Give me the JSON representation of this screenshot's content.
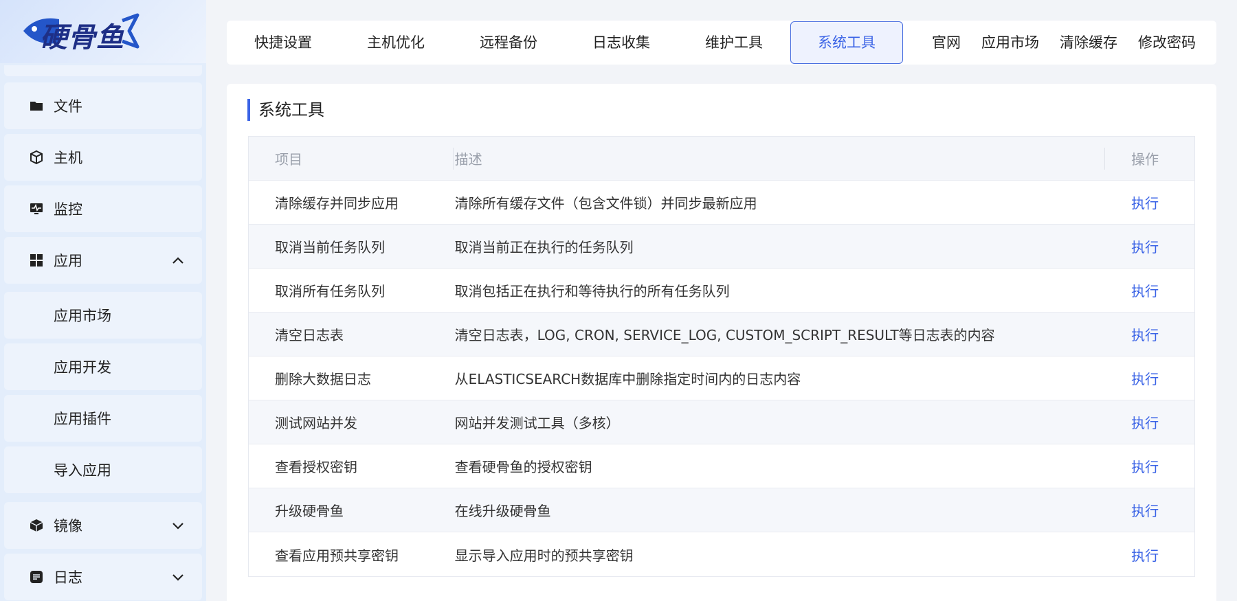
{
  "sidebar": {
    "logo_text": "硬骨鱼",
    "items": [
      {
        "label": "文件",
        "icon": "folder-icon"
      },
      {
        "label": "主机",
        "icon": "cube-icon"
      },
      {
        "label": "监控",
        "icon": "monitor-icon"
      },
      {
        "label": "应用",
        "icon": "grid-icon",
        "expanded": true
      },
      {
        "label": "应用市场",
        "sub": true
      },
      {
        "label": "应用开发",
        "sub": true
      },
      {
        "label": "应用插件",
        "sub": true
      },
      {
        "label": "导入应用",
        "sub": true
      },
      {
        "label": "镜像",
        "icon": "box-icon",
        "expanded": false
      },
      {
        "label": "日志",
        "icon": "log-icon",
        "expanded": false
      }
    ]
  },
  "topnav": {
    "items": [
      "快捷设置",
      "主机优化",
      "远程备份",
      "日志收集",
      "维护工具",
      "系统工具",
      "官网",
      "应用市场",
      "清除缓存",
      "修改密码"
    ],
    "active": "系统工具"
  },
  "card": {
    "title": "系统工具",
    "headers": {
      "item": "项目",
      "desc": "描述",
      "action": "操作"
    },
    "rows": [
      {
        "item": "清除缓存并同步应用",
        "desc": "清除所有缓存文件（包含文件锁）并同步最新应用",
        "action": "执行"
      },
      {
        "item": "取消当前任务队列",
        "desc": "取消当前正在执行的任务队列",
        "action": "执行"
      },
      {
        "item": "取消所有任务队列",
        "desc": "取消包括正在执行和等待执行的所有任务队列",
        "action": "执行"
      },
      {
        "item": "清空日志表",
        "desc": "清空日志表，LOG, CRON, SERVICE_LOG, CUSTOM_SCRIPT_RESULT等日志表的内容",
        "action": "执行"
      },
      {
        "item": "删除大数据日志",
        "desc": "从ELASTICSEARCH数据库中删除指定时间内的日志内容",
        "action": "执行"
      },
      {
        "item": "测试网站并发",
        "desc": "网站并发测试工具（多核）",
        "action": "执行"
      },
      {
        "item": "查看授权密钥",
        "desc": "查看硬骨鱼的授权密钥",
        "action": "执行"
      },
      {
        "item": "升级硬骨鱼",
        "desc": "在线升级硬骨鱼",
        "action": "执行"
      },
      {
        "item": "查看应用预共享密钥",
        "desc": "显示导入应用时的预共享密钥",
        "action": "执行"
      }
    ]
  },
  "colors": {
    "accent": "#3a63e6",
    "sidebar_bg": "#e3edfb",
    "item_bg": "#edf3fc"
  }
}
